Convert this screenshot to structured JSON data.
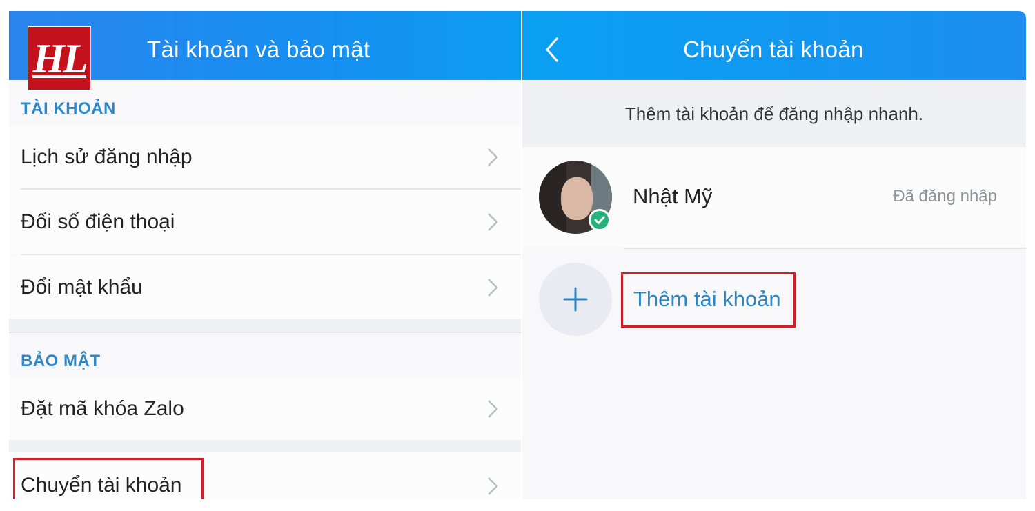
{
  "logo": {
    "text": "HL"
  },
  "left_screen": {
    "title": "Tài khoản và bảo mật",
    "sections": [
      {
        "header": "TÀI KHOẢN",
        "items": [
          {
            "label": "Lịch sử đăng nhập"
          },
          {
            "label": "Đổi số điện thoại"
          },
          {
            "label": "Đổi mật khẩu"
          }
        ]
      },
      {
        "header": "BẢO MẬT",
        "items": [
          {
            "label": "Đặt mã khóa Zalo"
          }
        ]
      }
    ],
    "switch_account": {
      "label": "Chuyển tài khoản"
    }
  },
  "right_screen": {
    "title": "Chuyển tài khoản",
    "hint": "Thêm tài khoản để đăng nhập nhanh.",
    "account": {
      "name": "Nhật Mỹ",
      "status": "Đã đăng nhập"
    },
    "add_account": {
      "label": "Thêm tài khoản"
    }
  },
  "colors": {
    "header_blue": "#1297f1",
    "section_header": "#2f87c8",
    "link_blue": "#2b86c6",
    "highlight_red": "#d01f29",
    "check_green": "#27b27a"
  },
  "icons": [
    "chevron-right-icon",
    "back-arrow-icon",
    "plus-icon",
    "check-icon"
  ]
}
